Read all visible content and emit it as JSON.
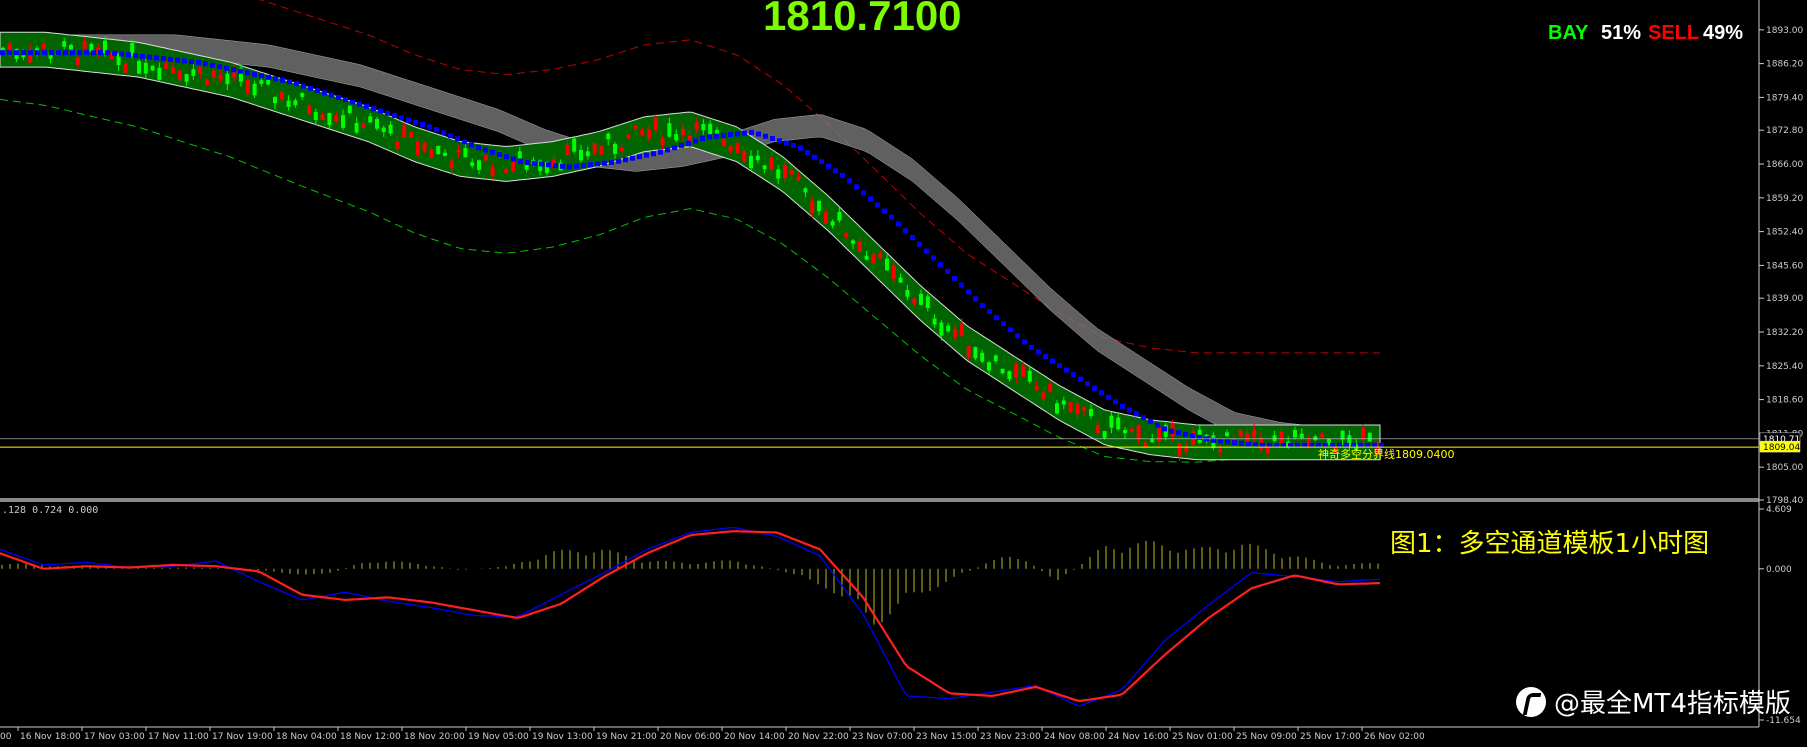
{
  "header": {
    "current_price": "1810.7100",
    "bay_label": "BAY",
    "bay_pct": "51%",
    "sell_label": "SELL",
    "sell_pct": "49%"
  },
  "caption": "图1：多空通道模板1小时图",
  "watermark": "@最全MT4指标模版",
  "indicator_label": ".128 0.724 0.000",
  "line_label": "神奇多空分界线1809.0400",
  "colors": {
    "up_candle": "#00ff00",
    "down_candle": "#ff0000",
    "channel_fill": "#006400",
    "blue_line": "#0000ff",
    "magenta": "#ff00ff",
    "gray_band": "#808080",
    "yellow_line": "#ffff00"
  },
  "chart_data": [
    {
      "type": "line",
      "title": "",
      "y_ticks": [
        "1893.00",
        "1886.20",
        "1879.40",
        "1872.80",
        "1866.00",
        "1859.20",
        "1852.40",
        "1845.60",
        "1839.00",
        "1832.20",
        "1825.40",
        "1818.60",
        "1811.80",
        "1805.00",
        "1798.40"
      ],
      "price_tags": [
        "1810.71",
        "1809.04"
      ],
      "horizontal_line": 1809.04,
      "ylim": [
        1798.4,
        1899.0
      ],
      "x_ticks": [
        "16 Nov 18:00",
        "17 Nov 03:00",
        "17 Nov 11:00",
        "17 Nov 19:00",
        "18 Nov 04:00",
        "18 Nov 12:00",
        "18 Nov 20:00",
        "19 Nov 05:00",
        "19 Nov 13:00",
        "19 Nov 21:00",
        "20 Nov 06:00",
        "20 Nov 14:00",
        "20 Nov 22:00",
        "23 Nov 07:00",
        "23 Nov 15:00",
        "23 Nov 23:00",
        "24 Nov 08:00",
        "24 Nov 16:00",
        "25 Nov 01:00",
        "25 Nov 09:00",
        "25 Nov 17:00",
        "26 Nov 02:00"
      ],
      "x_tick_partial": "00",
      "series": [
        {
          "values": [
            1889,
            1889,
            1888,
            1887,
            1885,
            1883,
            1880,
            1877,
            1874,
            1870,
            1867,
            1866,
            1867,
            1869,
            1872,
            1873,
            1870,
            1864,
            1856,
            1847,
            1838,
            1830,
            1824,
            1818,
            1813,
            1811,
            1810,
            1810,
            1810,
            1810,
            1810
          ]
        }
      ]
    },
    {
      "type": "line",
      "y_ticks": [
        "4.609",
        "0.000",
        "-11.654"
      ],
      "ylim": [
        -11.654,
        4.609
      ],
      "series": [
        {
          "color": "red",
          "values": [
            1.2,
            0,
            0.2,
            0.1,
            0.3,
            0.2,
            -0.2,
            -2,
            -2.4,
            -2.2,
            -2.6,
            -3.2,
            -3.8,
            -2.7,
            -0.6,
            1.2,
            2.6,
            2.9,
            2.8,
            1.5,
            -2.2,
            -7.5,
            -9.6,
            -9.8,
            -9.1,
            -10.2,
            -9.7,
            -6.6,
            -3.8,
            -1.5,
            -0.5,
            -1.2,
            -1.1
          ]
        },
        {
          "color": "blue",
          "values": [
            1.5,
            0.3,
            0.5,
            0.1,
            0.2,
            0.6,
            -1,
            -2.4,
            -1.8,
            -2.5,
            -3,
            -3.6,
            -3.7,
            -2,
            -0.3,
            1.5,
            2.8,
            3.2,
            2.5,
            1,
            -3.5,
            -9.8,
            -10,
            -9.5,
            -9,
            -10.6,
            -9.3,
            -5.5,
            -2.8,
            -0.3,
            -0.6,
            -1,
            -0.8
          ]
        },
        {
          "color": "olive",
          "type": "histogram",
          "values": [
            0.5,
            0.3,
            0.2,
            0.1,
            0.1,
            0.1,
            -0.3,
            -0.6,
            0.7,
            0.5,
            -0.1,
            0.2,
            1.4,
            1.7,
            0.7,
            0.5,
            0.7,
            -0.2,
            -1.6,
            -4.5,
            -2.1,
            -0.3,
            1.4,
            -1.1,
            1.9,
            2.2,
            1.6,
            2.1,
            1.2,
            0.3,
            0.5
          ]
        }
      ]
    }
  ]
}
